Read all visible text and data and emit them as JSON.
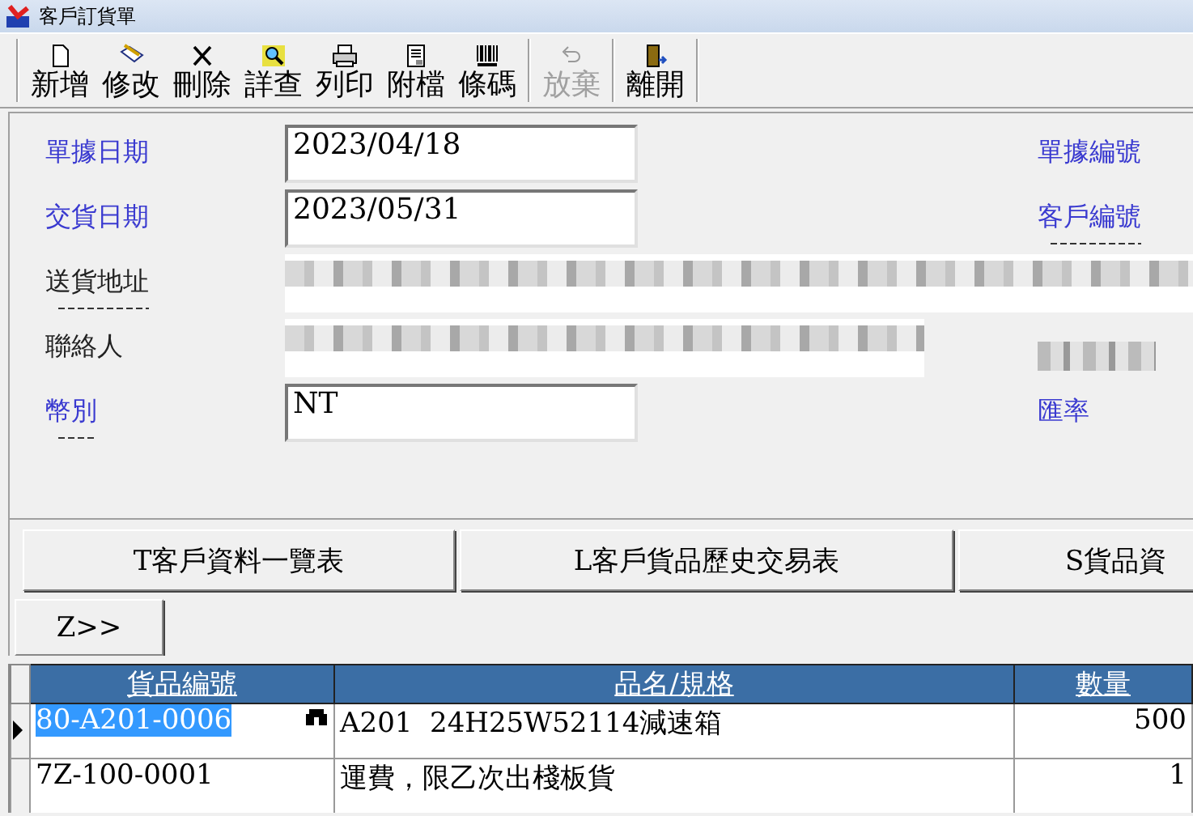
{
  "window": {
    "title": "客戶訂貨單"
  },
  "toolbar": {
    "groups": [
      [
        {
          "label": "新增",
          "disabled": false
        },
        {
          "label": "修改",
          "disabled": false
        },
        {
          "label": "刪除",
          "disabled": false
        },
        {
          "label": "詳查",
          "disabled": false
        },
        {
          "label": "列印",
          "disabled": false
        },
        {
          "label": "附檔",
          "disabled": false
        },
        {
          "label": "條碼",
          "disabled": false
        }
      ],
      [
        {
          "label": "放棄",
          "disabled": true
        }
      ],
      [
        {
          "label": "離開",
          "disabled": false
        }
      ]
    ]
  },
  "form": {
    "rows": [
      {
        "label": {
          "text": "單據日期",
          "kind": "link",
          "dashed": false
        },
        "field": {
          "kind": "text",
          "value": "2023/04/18"
        },
        "right_label": {
          "kind": "link",
          "text": "單據編號",
          "dashed": false
        }
      },
      {
        "label": {
          "text": "交貨日期",
          "kind": "link",
          "dashed": false
        },
        "field": {
          "kind": "text",
          "value": "2023/05/31"
        },
        "right_label": {
          "kind": "link",
          "text": "客戶編號",
          "dashed": true
        }
      },
      {
        "label": {
          "text": "送貨地址",
          "kind": "plain",
          "dashed": true
        },
        "field": {
          "kind": "blurred_wide"
        }
      },
      {
        "label": {
          "text": "聯絡人",
          "kind": "plain",
          "dashed": false
        },
        "field": {
          "kind": "blurred"
        },
        "right_label": {
          "kind": "blurred"
        }
      },
      {
        "label": {
          "text": "幣別",
          "kind": "link",
          "dashed": true
        },
        "field": {
          "kind": "text",
          "value": "NT"
        },
        "right_label": {
          "kind": "link",
          "text": "匯率",
          "dashed": false
        }
      }
    ]
  },
  "buttons": [
    "T客戶資料一覽表",
    "L客戶貨品歷史交易表",
    "S貨品資"
  ],
  "more_button": "Z>>",
  "grid": {
    "columns": [
      {
        "label": "貨品編號",
        "kind": "text"
      },
      {
        "label": "品名/規格",
        "kind": "text"
      },
      {
        "label": "數量",
        "kind": "number"
      }
    ],
    "rows": [
      {
        "selected": true,
        "cells": [
          "80-A201-0006",
          "A201  24H25W52114減速箱",
          "500"
        ]
      },
      {
        "selected": false,
        "cells": [
          "7Z-100-0001",
          "運費，限乙次出棧板貨",
          "1"
        ]
      }
    ]
  }
}
